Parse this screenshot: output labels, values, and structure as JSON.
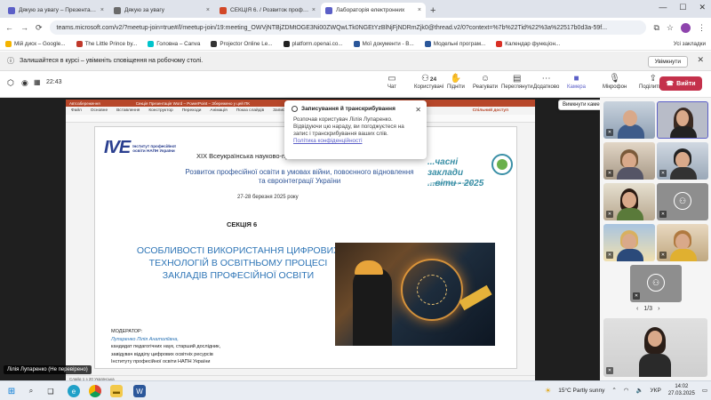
{
  "browser": {
    "tabs": [
      {
        "label": "Дякую за увагу – Презентація",
        "color": "#5b5fc7"
      },
      {
        "label": "Дякую за увагу",
        "color": "#6a6a6a"
      },
      {
        "label": "СЕКЦІЯ 6. / Розвиток професі",
        "color": "#d24726"
      },
      {
        "label": "Лабораторія електронних",
        "color": "#5b5fc7",
        "active": true
      }
    ],
    "url": "teams.microsoft.com/v2/?meetup-join=true#/l/meetup-join/19:meeting_OWVjNTBjZDMtOGE3Ni00ZWQwLTk0NGEtYzBlNjFjNDRmZjk0@thread.v2/0?context=%7b%22Tid%22%3a%22517b0d3a-59f...",
    "bookmarks": [
      {
        "label": "Мій диск – Google...",
        "color": "#f4b400"
      },
      {
        "label": "The Little Prince by...",
        "color": "#c0392b"
      },
      {
        "label": "Головна – Canva",
        "color": "#00c4cc"
      },
      {
        "label": "Projector Online Le...",
        "color": "#333"
      },
      {
        "label": "platform.openai.co...",
        "color": "#222"
      },
      {
        "label": "Мої документи - B...",
        "color": "#2b579a"
      },
      {
        "label": "Модельні програм...",
        "color": "#2b579a"
      },
      {
        "label": "Календар функціон...",
        "color": "#d93025"
      }
    ],
    "all_bookmarks": "Усі закладки"
  },
  "notification": {
    "text": "Залишайтеся в курсі – увімкніть сповіщення на робочому столі.",
    "button": "Увімкнути"
  },
  "meeting": {
    "time": "22:43",
    "controls": [
      {
        "label": "Чат",
        "icon": "chat-icon"
      },
      {
        "label": "Користувачі",
        "icon": "people-icon",
        "count": "24"
      },
      {
        "label": "Підніти",
        "icon": "hand-icon"
      },
      {
        "label": "Реагувати",
        "icon": "emoji-icon"
      },
      {
        "label": "Переглянути",
        "icon": "view-icon"
      },
      {
        "label": "Додатково",
        "icon": "more-icon"
      },
      {
        "label": "Камера",
        "icon": "camera-icon"
      },
      {
        "label": "Мікрофон",
        "icon": "mic-icon"
      },
      {
        "label": "Поділитися",
        "icon": "share-icon"
      }
    ],
    "leave": "Вийти",
    "tooltip": "Вимкнути камеру (Ctrl+Shift+O)",
    "presenter_name": "Лілія Лупаренко (Не перевірено)",
    "pager": "1/3"
  },
  "dialog": {
    "title": "Записування й транскрибування",
    "body": "Розпочав користувач Лілія Лупаренко. Відвідуючи цю нараду, ви погоджуєтеся на запис і транскрибування ваших слів.",
    "link": "Політика конфіденційності"
  },
  "ppt": {
    "title_left": "Автозбереження",
    "title_center": "Секція Презентація Word – PowerPoint – Збережено у цей ПК",
    "menu": [
      "Файл",
      "Основне",
      "Вставлення",
      "Конструктор",
      "Переходи",
      "Анімація",
      "Показ слайдів",
      "Запис",
      "Рецензування",
      "Подання",
      "Довідка"
    ],
    "share": "Спільний доступ",
    "status": "Слайд 1 з 20  Українська"
  },
  "slide": {
    "logo_big": "IVE",
    "logo_small": "Інститут професійної освіти НАПН України",
    "conference": "XIX Всеукраїнська науково-пр...",
    "subtitle": "Розвиток професійної освіти в умовах війни, повоєнного відновлення та євроінтеграції України",
    "date": "27-28 березня 2025 року",
    "right_title": "...часні заклади ...віти - 2025",
    "right_sub": "...ства для інновацій освіти",
    "section": "СЕКЦІЯ 6",
    "heading": "ОСОБЛИВОСТІ ВИКОРИСТАННЯ ЦИФРОВИХ ТЕХНОЛОГІЙ В ОСВІТНЬОМУ ПРОЦЕСІ ЗАКЛАДІВ ПРОФЕСІЙНОЇ ОСВІТИ",
    "moderator_label": "МОДЕРАТОР:",
    "moderator_name": "Лупаренко Лілія Анатоліївна,",
    "moderator_lines": [
      "кандидат педагогічних наук, старший дослідник,",
      "завідувач відділу цифрових освітніх ресурсів",
      "Інституту професійної освіти НАПН України"
    ]
  },
  "taskbar": {
    "weather": "15°C  Partly sunny",
    "lang": "УКР",
    "time": "14:02",
    "date": "27.03.2025"
  }
}
